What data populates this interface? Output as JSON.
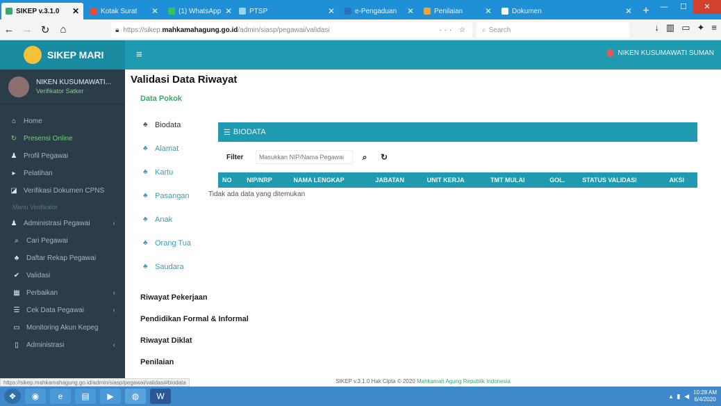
{
  "browser": {
    "tabs": [
      {
        "label": "SIKEP v.3.1.0",
        "active": true
      },
      {
        "label": "Kotak Surat",
        "active": false
      },
      {
        "label": "(1) WhatsApp",
        "active": false
      },
      {
        "label": "PTSP",
        "active": false
      },
      {
        "label": "e-Pengaduan",
        "active": false
      },
      {
        "label": "Penilaian",
        "active": false
      },
      {
        "label": "Dokumen",
        "active": false
      }
    ],
    "url_prefix": "https://sikep.",
    "url_host": "mahkamahagung.go.id",
    "url_path": "/admin/siasp/pegawai/validasi",
    "search_placeholder": "Search"
  },
  "app": {
    "brand": "SIKEP MARI",
    "header_user": "NIKEN KUSUMAWATI SUMAN",
    "sidebar": {
      "user_name": "NIKEN KUSUMAWATI...",
      "user_role": "Verifikator Satker",
      "items": [
        {
          "icon": "home-icon",
          "label": "Home",
          "active": false
        },
        {
          "icon": "refresh-icon",
          "label": "Presensi Online",
          "active": true
        },
        {
          "icon": "user-icon",
          "label": "Profil Pegawai",
          "active": false
        },
        {
          "icon": "file-icon",
          "label": "Pelatihan",
          "active": false
        },
        {
          "icon": "chart-icon",
          "label": "Verifikasi Dokumen CPNS",
          "active": false
        }
      ],
      "section_header": "Menu Verifikator",
      "admin_items": [
        {
          "icon": "user-icon",
          "label": "Administrasi Pegawai",
          "caret": true
        },
        {
          "icon": "search-icon",
          "label": "Cari Pegawai",
          "caret": false
        },
        {
          "icon": "users-icon",
          "label": "Daftar Rekap Pegawai",
          "caret": false
        },
        {
          "icon": "check-icon",
          "label": "Validasi",
          "caret": false
        },
        {
          "icon": "calendar-icon",
          "label": "Perbaikan",
          "caret": true
        },
        {
          "icon": "list-icon",
          "label": "Cek Data Pegawai",
          "caret": true
        },
        {
          "icon": "monitor-icon",
          "label": "Monitoring Akun Kepeg",
          "caret": false
        },
        {
          "icon": "file-icon",
          "label": "Administrasi",
          "caret": true
        }
      ]
    }
  },
  "main": {
    "title": "Validasi Data Riwayat",
    "subtitle": "Data Pokok",
    "subnav": [
      "Biodata",
      "Alamat",
      "Kartu",
      "Pasangan",
      "Anak",
      "Orang Tua",
      "Saudara"
    ],
    "panel_title": "BIODATA",
    "filter_label": "Filter",
    "filter_placeholder": "Masukkan NIP/Nama Pegawai",
    "columns": [
      "NO",
      "NIP/NRP",
      "NAMA LENGKAP",
      "JABATAN",
      "UNIT KERJA",
      "TMT MULAI",
      "GOL.",
      "STATUS VALIDASI",
      "AKSI"
    ],
    "empty_message": "Tidak ada data yang ditemukan",
    "sections": [
      "Riwayat Pekerjaan",
      "Pendidikan Formal & Informal",
      "Riwayat Diklat",
      "Penilaian"
    ],
    "footer_prefix": "SIKEP v.3.1.0 Hak Cipta © 2020",
    "footer_org": "Mahkamah Agung Republik Indonesia"
  },
  "status_url": "https://sikep.mahkamahagung.go.id/admin/siasp/pegawai/validasi#biodata",
  "taskbar": {
    "time": "10:28 AM",
    "date": "6/4/2020"
  }
}
